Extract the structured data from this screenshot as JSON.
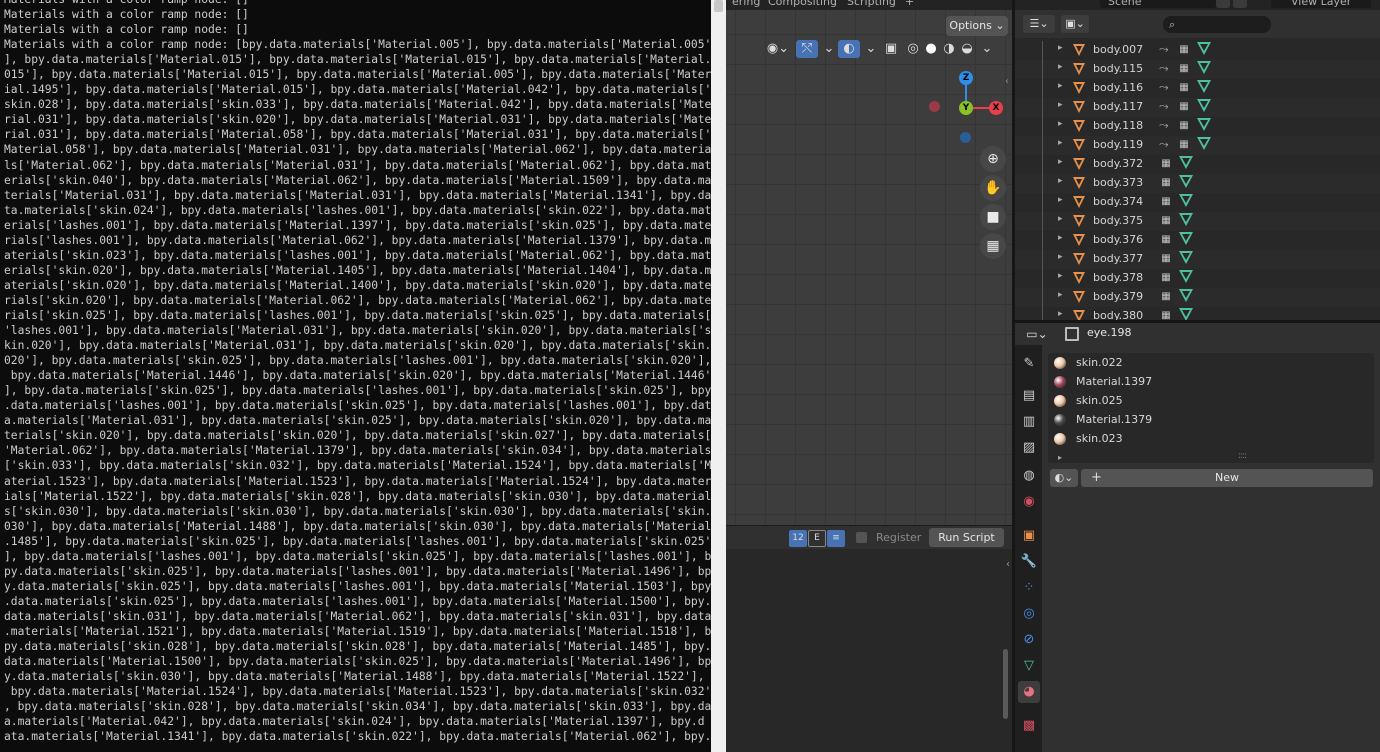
{
  "console": {
    "lines": [
      "Materials with a color ramp node: []",
      "Materials with a color ramp node: []",
      "Materials with a color ramp node: []",
      "Materials with a color ramp node: [bpy.data.materials['Material.005'], bpy.data.materials['Material.005'",
      "], bpy.data.materials['Material.015'], bpy.data.materials['Material.015'], bpy.data.materials['Material.",
      "015'], bpy.data.materials['Material.015'], bpy.data.materials['Material.005'], bpy.data.materials['Mater",
      "ial.1495'], bpy.data.materials['Material.015'], bpy.data.materials['Material.042'], bpy.data.materials['",
      "skin.028'], bpy.data.materials['skin.033'], bpy.data.materials['Material.042'], bpy.data.materials['Mate",
      "rial.031'], bpy.data.materials['skin.020'], bpy.data.materials['Material.031'], bpy.data.materials['Mate",
      "rial.031'], bpy.data.materials['Material.058'], bpy.data.materials['Material.031'], bpy.data.materials['",
      "Material.058'], bpy.data.materials['Material.031'], bpy.data.materials['Material.062'], bpy.data.materia",
      "ls['Material.062'], bpy.data.materials['Material.031'], bpy.data.materials['Material.062'], bpy.data.mat",
      "erials['skin.040'], bpy.data.materials['Material.062'], bpy.data.materials['Material.1509'], bpy.data.ma",
      "terials['Material.031'], bpy.data.materials['Material.031'], bpy.data.materials['Material.1341'], bpy.da",
      "ta.materials['skin.024'], bpy.data.materials['lashes.001'], bpy.data.materials['skin.022'], bpy.data.mat",
      "erials['lashes.001'], bpy.data.materials['Material.1397'], bpy.data.materials['skin.025'], bpy.data.mate",
      "rials['lashes.001'], bpy.data.materials['Material.062'], bpy.data.materials['Material.1379'], bpy.data.m",
      "aterials['skin.023'], bpy.data.materials['lashes.001'], bpy.data.materials['Material.062'], bpy.data.mat",
      "erials['skin.020'], bpy.data.materials['Material.1405'], bpy.data.materials['Material.1404'], bpy.data.m",
      "aterials['skin.020'], bpy.data.materials['Material.1400'], bpy.data.materials['skin.020'], bpy.data.mate",
      "rials['skin.020'], bpy.data.materials['Material.062'], bpy.data.materials['Material.062'], bpy.data.mate",
      "rials['skin.025'], bpy.data.materials['lashes.001'], bpy.data.materials['skin.025'], bpy.data.materials[",
      "'lashes.001'], bpy.data.materials['Material.031'], bpy.data.materials['skin.020'], bpy.data.materials['s",
      "kin.020'], bpy.data.materials['Material.031'], bpy.data.materials['skin.020'], bpy.data.materials['skin.",
      "020'], bpy.data.materials['skin.025'], bpy.data.materials['lashes.001'], bpy.data.materials['skin.020'],",
      " bpy.data.materials['Material.1446'], bpy.data.materials['skin.020'], bpy.data.materials['Material.1446'",
      "], bpy.data.materials['skin.025'], bpy.data.materials['lashes.001'], bpy.data.materials['skin.025'], bpy",
      ".data.materials['lashes.001'], bpy.data.materials['skin.025'], bpy.data.materials['lashes.001'], bpy.dat",
      "a.materials['Material.031'], bpy.data.materials['skin.025'], bpy.data.materials['skin.020'], bpy.data.ma",
      "terials['skin.020'], bpy.data.materials['skin.020'], bpy.data.materials['skin.027'], bpy.data.materials[",
      "'Material.062'], bpy.data.materials['Material.1379'], bpy.data.materials['skin.034'], bpy.data.materials",
      "['skin.033'], bpy.data.materials['skin.032'], bpy.data.materials['Material.1524'], bpy.data.materials['M",
      "aterial.1523'], bpy.data.materials['Material.1523'], bpy.data.materials['Material.1524'], bpy.data.mater",
      "ials['Material.1522'], bpy.data.materials['skin.028'], bpy.data.materials['skin.030'], bpy.data.material",
      "s['skin.030'], bpy.data.materials['skin.030'], bpy.data.materials['skin.030'], bpy.data.materials['skin.",
      "030'], bpy.data.materials['Material.1488'], bpy.data.materials['skin.030'], bpy.data.materials['Material",
      ".1485'], bpy.data.materials['skin.025'], bpy.data.materials['lashes.001'], bpy.data.materials['skin.025'",
      "], bpy.data.materials['lashes.001'], bpy.data.materials['skin.025'], bpy.data.materials['lashes.001'], b",
      "py.data.materials['skin.025'], bpy.data.materials['lashes.001'], bpy.data.materials['Material.1496'], bp",
      "y.data.materials['skin.025'], bpy.data.materials['lashes.001'], bpy.data.materials['Material.1503'], bpy",
      ".data.materials['skin.025'], bpy.data.materials['lashes.001'], bpy.data.materials['Material.1500'], bpy.",
      "data.materials['skin.031'], bpy.data.materials['Material.062'], bpy.data.materials['skin.031'], bpy.data",
      ".materials['Material.1521'], bpy.data.materials['Material.1519'], bpy.data.materials['Material.1518'], b",
      "py.data.materials['skin.028'], bpy.data.materials['skin.028'], bpy.data.materials['Material.1485'], bpy.",
      "data.materials['Material.1500'], bpy.data.materials['skin.025'], bpy.data.materials['Material.1496'], bp",
      "y.data.materials['skin.030'], bpy.data.materials['Material.1488'], bpy.data.materials['Material.1522'],",
      " bpy.data.materials['Material.1524'], bpy.data.materials['Material.1523'], bpy.data.materials['skin.032']",
      ", bpy.data.materials['skin.028'], bpy.data.materials['skin.034'], bpy.data.materials['skin.033'], bpy.dat",
      "a.materials['Material.042'], bpy.data.materials['skin.024'], bpy.data.materials['Material.1397'], bpy.d",
      "ata.materials['Material.1341'], bpy.data.materials['skin.022'], bpy.data.materials['Material.062'], bpy."
    ]
  },
  "topbar": {
    "tabs": [
      "ering",
      "Compositing",
      "Scripting",
      "+"
    ],
    "scene_label": "Scene",
    "view_layer_label": "View Layer"
  },
  "viewport": {
    "options_label": "Options",
    "gizmo": {
      "z": "Z",
      "y": "Y",
      "x": "X"
    }
  },
  "text_editor": {
    "register_label": "Register",
    "run_script_label": "Run Script"
  },
  "outliner": {
    "rows": [
      {
        "name": "body.007",
        "modifier": true
      },
      {
        "name": "body.115",
        "modifier": true
      },
      {
        "name": "body.116",
        "modifier": true
      },
      {
        "name": "body.117",
        "modifier": true
      },
      {
        "name": "body.118",
        "modifier": true
      },
      {
        "name": "body.119",
        "modifier": true
      },
      {
        "name": "body.372",
        "modifier": false
      },
      {
        "name": "body.373",
        "modifier": false
      },
      {
        "name": "body.374",
        "modifier": false
      },
      {
        "name": "body.375",
        "modifier": false
      },
      {
        "name": "body.376",
        "modifier": false
      },
      {
        "name": "body.377",
        "modifier": false
      },
      {
        "name": "body.378",
        "modifier": false
      },
      {
        "name": "body.379",
        "modifier": false
      },
      {
        "name": "body.380",
        "modifier": false
      }
    ]
  },
  "properties": {
    "object_name": "eye.198",
    "materials": [
      {
        "name": "skin.022",
        "color": "#f2c9a8"
      },
      {
        "name": "Material.1397",
        "color": "#a0485a"
      },
      {
        "name": "skin.025",
        "color": "#f2c9a8"
      },
      {
        "name": "Material.1379",
        "color": "#4a4a4a"
      },
      {
        "name": "skin.023",
        "color": "#f2c9a8"
      }
    ],
    "new_label": "New"
  },
  "colors": {
    "accent_blue": "#4772b3",
    "object_orange": "#e8904a",
    "mesh_green": "#4ec0a0",
    "axis_x": "#e8404a",
    "axis_y": "#8ac226",
    "axis_z": "#2e8fe8"
  }
}
